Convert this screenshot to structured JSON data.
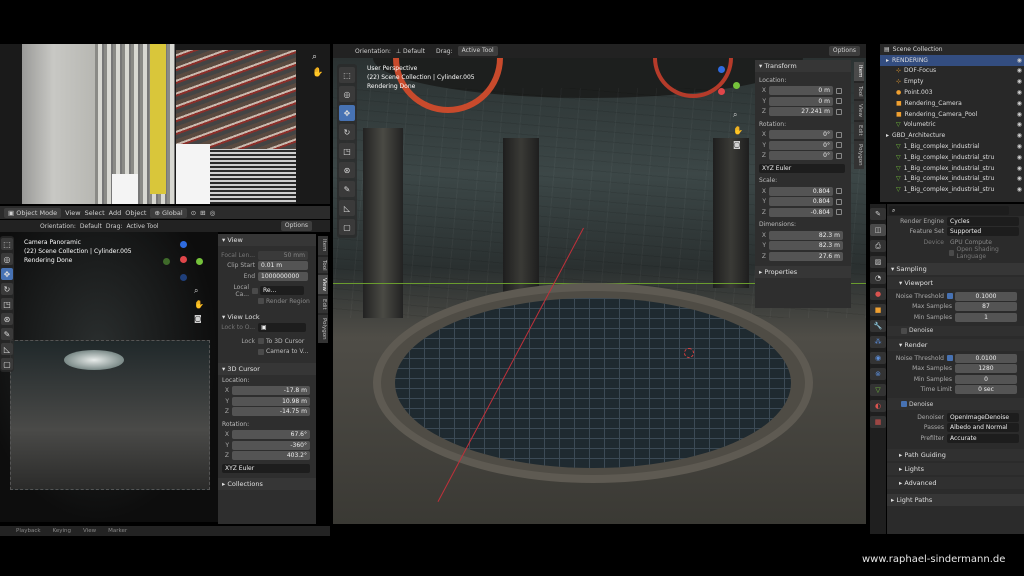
{
  "watermark": "www.raphael-sindermann.de",
  "main_view": {
    "orientation_label": "Orientation:",
    "orientation_value": "Default",
    "drag_label": "Drag:",
    "drag_value": "Active Tool",
    "options": "Options",
    "overlay": [
      "User Perspective",
      "(22) Scene Collection | Cylinder.005",
      "Rendering Done"
    ],
    "tabs": [
      "Item",
      "Tool",
      "View",
      "Edit",
      "Polygon"
    ]
  },
  "left_view": {
    "mode": "Object Mode",
    "menus": [
      "View",
      "Select",
      "Add",
      "Object"
    ],
    "transform": "Global",
    "orientation_label": "Orientation:",
    "orientation_value": "Default",
    "drag_label": "Drag:",
    "drag_value": "Active Tool",
    "options": "Options",
    "overlay": [
      "Camera Panoramic",
      "(22) Scene Collection | Cylinder.005",
      "Rendering Done"
    ],
    "tabs": [
      "Item",
      "Tool",
      "View",
      "Edit",
      "Polygon"
    ],
    "bottom_menus": [
      "Playback",
      "Keying",
      "View",
      "Marker"
    ]
  },
  "transform": {
    "title": "Transform",
    "location": "Location:",
    "loc": [
      {
        "a": "X",
        "v": "0 m"
      },
      {
        "a": "Y",
        "v": "0 m"
      },
      {
        "a": "Z",
        "v": "27.241 m"
      }
    ],
    "rotation": "Rotation:",
    "rot": [
      {
        "a": "X",
        "v": "0°"
      },
      {
        "a": "Y",
        "v": "0°"
      },
      {
        "a": "Z",
        "v": "0°"
      }
    ],
    "rot_mode": "XYZ Euler",
    "scale": "Scale:",
    "scl": [
      {
        "a": "X",
        "v": "0.804"
      },
      {
        "a": "Y",
        "v": "0.804"
      },
      {
        "a": "Z",
        "v": "-0.804"
      }
    ],
    "dimensions": "Dimensions:",
    "dim": [
      {
        "a": "X",
        "v": "82.3 m"
      },
      {
        "a": "Y",
        "v": "82.3 m"
      },
      {
        "a": "Z",
        "v": "27.6 m"
      }
    ],
    "properties": "Properties"
  },
  "view_panel": {
    "title": "View",
    "focal_label": "Focal Len...",
    "focal": "50 mm",
    "clip_start_label": "Clip Start",
    "clip_start": "0.01 m",
    "end_label": "End",
    "end": "1000000000",
    "local_camera": "Local Ca...",
    "local_camera_value": "Re...",
    "render_region": "Render Region",
    "view_lock": "View Lock",
    "lock_to": "Lock to O...",
    "lock_label": "Lock",
    "to_cursor": "To 3D Cursor",
    "camera_to": "Camera to V...",
    "cursor_title": "3D Cursor",
    "location": "Location:",
    "loc": [
      {
        "a": "X",
        "v": "-17.8 m"
      },
      {
        "a": "Y",
        "v": "10.98 m"
      },
      {
        "a": "Z",
        "v": "-14.75 m"
      }
    ],
    "rotation": "Rotation:",
    "rot": [
      {
        "a": "X",
        "v": "67.6°"
      },
      {
        "a": "Y",
        "v": "-360°"
      },
      {
        "a": "Z",
        "v": "403.2°"
      }
    ],
    "rot_mode": "XYZ Euler",
    "collections": "Collections"
  },
  "outliner": {
    "root": "Scene Collection",
    "items": [
      {
        "n": "RENDERING",
        "i": "▸"
      },
      {
        "n": "DOF-Focus",
        "i": "⊹"
      },
      {
        "n": "Empty",
        "i": "⊹"
      },
      {
        "n": "Point.003",
        "i": "●"
      },
      {
        "n": "Rendering_Camera",
        "i": "■"
      },
      {
        "n": "Rendering_Camera_Pool",
        "i": "■"
      },
      {
        "n": "Volumetric",
        "i": "▽"
      },
      {
        "n": "GBD_Architecture",
        "i": "▸"
      },
      {
        "n": "1_Big_complex_industrial",
        "i": "▽"
      },
      {
        "n": "1_Big_complex_industrial_stru",
        "i": "▽"
      },
      {
        "n": "1_Big_complex_industrial_stru",
        "i": "▽"
      },
      {
        "n": "1_Big_complex_industrial_stru",
        "i": "▽"
      },
      {
        "n": "1_Big_complex_industrial_stru",
        "i": "▽"
      }
    ]
  },
  "props": {
    "render_engine_label": "Render Engine",
    "render_engine": "Cycles",
    "feature_set_label": "Feature Set",
    "feature_set": "Supported",
    "device_label": "Device",
    "device": "GPU Compute",
    "osl": "Open Shading Language",
    "sampling": "Sampling",
    "viewport": "Viewport",
    "noise_threshold": "Noise Threshold",
    "vp_noise": "0.1000",
    "max_samples": "Max Samples",
    "vp_max": "87",
    "min_samples": "Min Samples",
    "vp_min": "1",
    "denoise": "Denoise",
    "render": "Render",
    "r_noise": "0.0100",
    "r_max": "1280",
    "r_min": "0",
    "time_limit": "Time Limit",
    "r_time": "0 sec",
    "denoiser_label": "Denoiser",
    "denoiser": "OpenImageDenoise",
    "passes_label": "Passes",
    "passes": "Albedo and Normal",
    "prefilter_label": "Prefilter",
    "prefilter": "Accurate",
    "path_guiding": "Path Guiding",
    "lights": "Lights",
    "advanced": "Advanced",
    "light_paths": "Light Paths"
  }
}
